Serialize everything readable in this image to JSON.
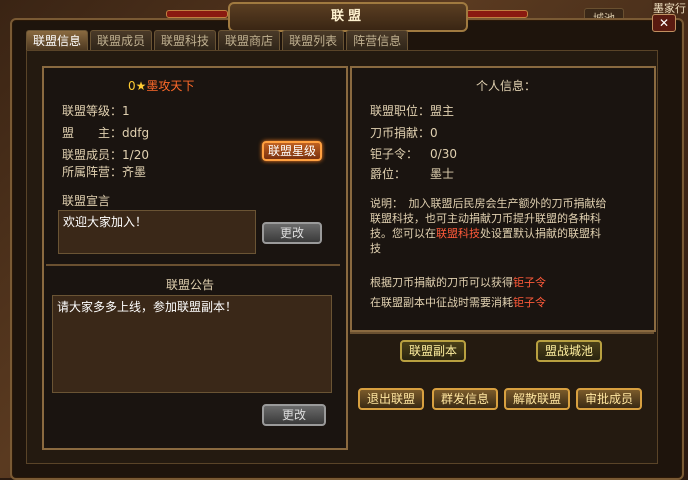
{
  "background": {
    "corner_text": "墨家行",
    "top_tabs": [
      "城池",
      "操驻",
      "魔家"
    ]
  },
  "window": {
    "title": "联盟",
    "close_label": "✕"
  },
  "tabs": [
    {
      "label": "联盟信息",
      "active": true
    },
    {
      "label": "联盟成员",
      "active": false
    },
    {
      "label": "联盟科技",
      "active": false
    },
    {
      "label": "联盟商店",
      "active": false
    },
    {
      "label": "联盟列表",
      "active": false
    },
    {
      "label": "阵营信息",
      "active": false
    }
  ],
  "alliance": {
    "level_prefix": "0",
    "star": "★",
    "name": "墨攻天下",
    "level_label": "联盟等级：",
    "level_value": "1",
    "leader_label": "盟　　主：",
    "leader_value": "ddfg",
    "members_label": "联盟成员：",
    "members_value": "1/20",
    "faction_label": "所属阵营：",
    "faction_value": "齐墨",
    "star_button": "联盟星级",
    "declaration_label": "联盟宣言",
    "declaration_text": "欢迎大家加入！",
    "declaration_change": "更改",
    "notice_label": "联盟公告",
    "notice_text": "请大家多多上线，参加联盟副本！",
    "notice_change": "更改"
  },
  "personal": {
    "title": "个人信息：",
    "position_label": "联盟职位：",
    "position_value": "盟主",
    "donation_label": "刀币捐献：",
    "donation_value": "0",
    "token_label": "钜子令：",
    "token_value": "0/30",
    "rank_label": "爵位：",
    "rank_value": "墨士",
    "desc_line1": "说明：　加入联盟后民房会生产额外的刀币捐献给",
    "desc_line2": "联盟科技，也可主动捐献刀币提升联盟的各种科",
    "desc_line3_a": "技。您可以在",
    "desc_line3_link": "联盟科技",
    "desc_line3_b": "处设置默认捐献的联盟科",
    "desc_line4": "技",
    "tip1_a": "根据刀币捐献的刀币可以获得",
    "tip1_b": "钜子令",
    "tip2_a": "在联盟副本中征战时需要消耗",
    "tip2_b": "钜子令"
  },
  "actions": {
    "dungeon": "联盟副本",
    "city_battle": "盟战城池",
    "quit": "退出联盟",
    "broadcast": "群发信息",
    "disband": "解散联盟",
    "approve": "审批成员"
  }
}
